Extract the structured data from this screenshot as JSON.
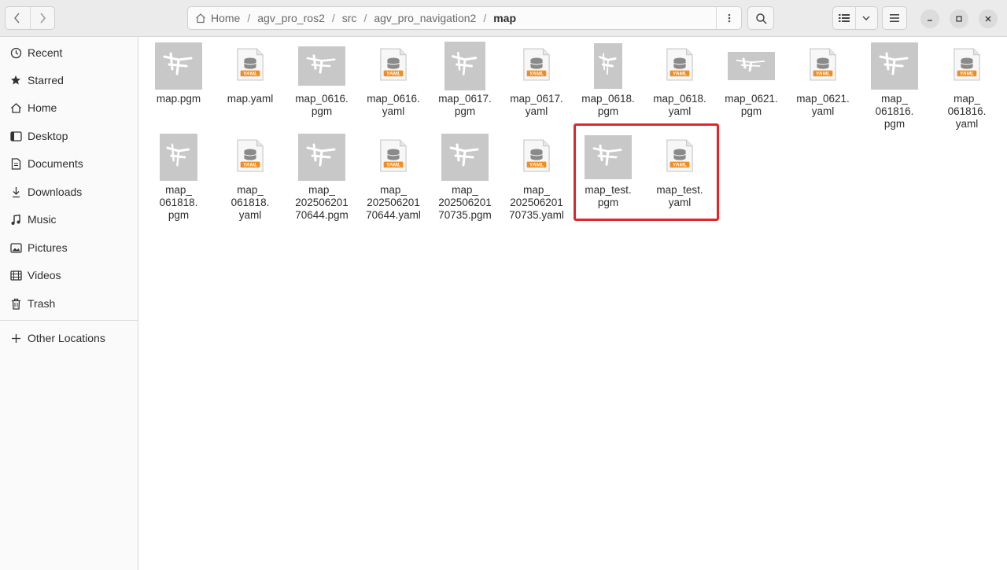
{
  "breadcrumb": {
    "items": [
      "Home",
      "agv_pro_ros2",
      "src",
      "agv_pro_navigation2",
      "map"
    ],
    "separator": "/"
  },
  "sidebar": {
    "items": [
      {
        "label": "Recent",
        "icon": "clock-icon"
      },
      {
        "label": "Starred",
        "icon": "star-icon"
      },
      {
        "label": "Home",
        "icon": "home-icon"
      },
      {
        "label": "Desktop",
        "icon": "desktop-icon"
      },
      {
        "label": "Documents",
        "icon": "document-icon"
      },
      {
        "label": "Downloads",
        "icon": "download-icon"
      },
      {
        "label": "Music",
        "icon": "music-icon"
      },
      {
        "label": "Pictures",
        "icon": "picture-icon"
      },
      {
        "label": "Videos",
        "icon": "video-icon"
      },
      {
        "label": "Trash",
        "icon": "trash-icon"
      }
    ],
    "other_locations": "Other Locations"
  },
  "files": [
    {
      "name": "map.pgm",
      "type": "pgm"
    },
    {
      "name": "map.yaml",
      "type": "yaml"
    },
    {
      "name": "map_0616.\npgm",
      "type": "pgm"
    },
    {
      "name": "map_0616.\nyaml",
      "type": "yaml"
    },
    {
      "name": "map_0617.\npgm",
      "type": "pgm"
    },
    {
      "name": "map_0617.\nyaml",
      "type": "yaml"
    },
    {
      "name": "map_0618.\npgm",
      "type": "pgm"
    },
    {
      "name": "map_0618.\nyaml",
      "type": "yaml"
    },
    {
      "name": "map_0621.\npgm",
      "type": "pgm"
    },
    {
      "name": "map_0621.\nyaml",
      "type": "yaml"
    },
    {
      "name": "map_\n061816.\npgm",
      "type": "pgm"
    },
    {
      "name": "map_\n061816.\nyaml",
      "type": "yaml"
    },
    {
      "name": "map_\n061818.\npgm",
      "type": "pgm"
    },
    {
      "name": "map_\n061818.\nyaml",
      "type": "yaml"
    },
    {
      "name": "map_\n202506201\n70644.pgm",
      "type": "pgm"
    },
    {
      "name": "map_\n202506201\n70644.yaml",
      "type": "yaml"
    },
    {
      "name": "map_\n202506201\n70735.pgm",
      "type": "pgm"
    },
    {
      "name": "map_\n202506201\n70735.yaml",
      "type": "yaml"
    },
    {
      "name": "map_test.\npgm",
      "type": "pgm"
    },
    {
      "name": "map_test.\nyaml",
      "type": "yaml"
    }
  ],
  "yaml_badge": "YAML",
  "colors": {
    "highlight": "#e0262b",
    "yaml_orange": "#f28c1e",
    "pgm_bg": "#c8c8c8"
  }
}
